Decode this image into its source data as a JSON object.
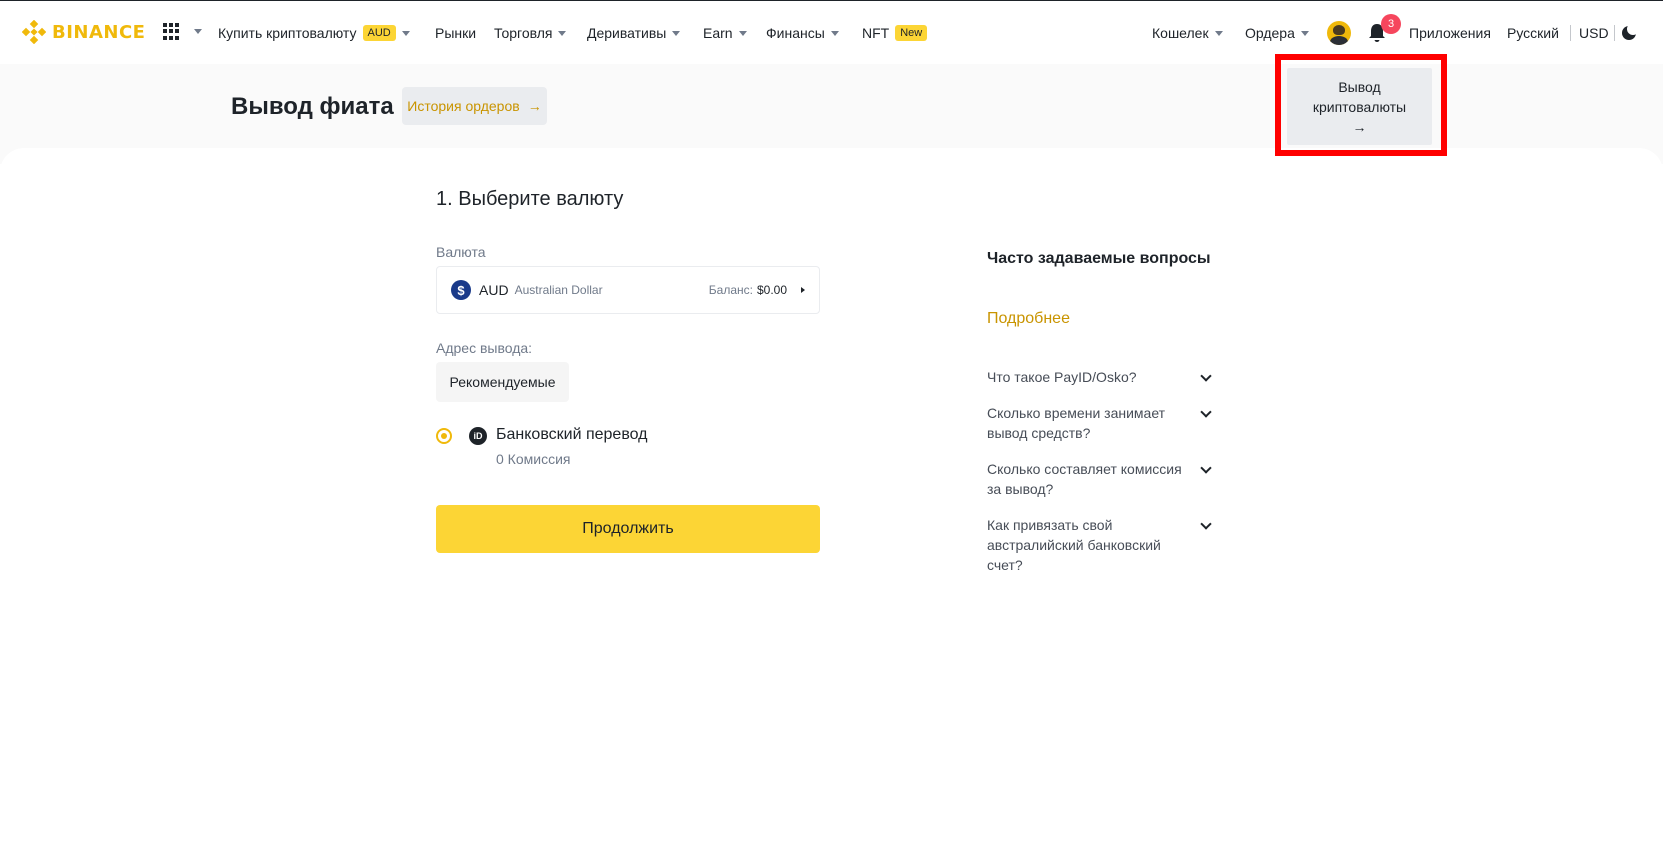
{
  "nav": {
    "logo_text": "BINANCE",
    "buy_crypto": "Купить криптовалюту",
    "buy_crypto_badge": "AUD",
    "markets": "Рынки",
    "trade": "Торговля",
    "derivatives": "Деривативы",
    "earn": "Earn",
    "finance": "Финансы",
    "nft": "NFT",
    "nft_badge": "New",
    "wallet": "Кошелек",
    "orders": "Ордера",
    "notifications_count": "3",
    "apps": "Приложения",
    "language": "Русский",
    "currency": "USD"
  },
  "header": {
    "title": "Вывод фиата",
    "history_button": "История ордеров",
    "history_arrow": "→",
    "crypto_withdraw_line1": "Вывод",
    "crypto_withdraw_line2": "криптовалюты",
    "crypto_withdraw_arrow": "→"
  },
  "form": {
    "step_title": "1. Выберите валюту",
    "currency_label": "Валюта",
    "currency_symbol": "$",
    "currency_code": "AUD",
    "currency_name": "Australian Dollar",
    "balance_label": "Баланс:",
    "balance_value": "$0.00",
    "address_label": "Адрес вывода:",
    "recommended_tab": "Рекомендуемые",
    "method_name": "Банковский перевод",
    "method_fee": "0 Комиссия",
    "continue_button": "Продолжить"
  },
  "faq": {
    "title": "Часто задаваемые вопросы",
    "more": "Подробнее",
    "items": [
      "Что такое PayID/Osko?",
      "Сколько времени занимает вывод средств?",
      "Сколько составляет комиссия за вывод?",
      "Как привязать свой австралийский банковский счет?"
    ]
  },
  "colors": {
    "brand_yellow": "#fcd535",
    "brand_gold": "#f0b90b",
    "link_gold": "#c99400",
    "highlight_red": "#ff0000",
    "notification_red": "#f6465d"
  }
}
